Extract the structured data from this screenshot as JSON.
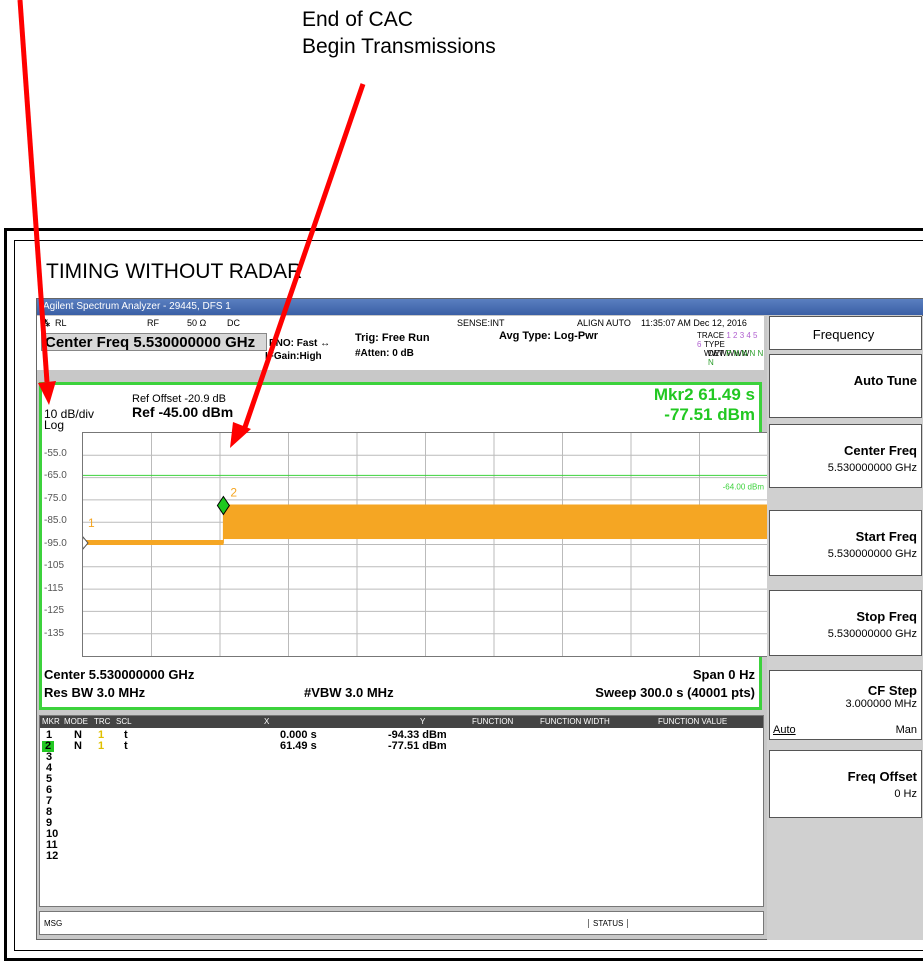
{
  "annotation": {
    "line1": "End of CAC",
    "line2": "Begin Transmissions"
  },
  "figure_title": "TIMING WITHOUT RADAR",
  "window_title": "Agilent Spectrum Analyzer - 29445, DFS 1",
  "status": {
    "rl": "RL",
    "rf": "RF",
    "ohm": "50 Ω",
    "dc": "DC",
    "sense": "SENSE:INT",
    "align": "ALIGN AUTO",
    "datetime": "11:35:07 AM Dec 12, 2016"
  },
  "header": {
    "center_freq": "Center Freq  5.530000000 GHz",
    "pno": "PNO: Fast",
    "ifgain": "IFGain:High",
    "trig": "Trig: Free Run",
    "atten": "#Atten: 0 dB",
    "avg": "Avg Type: Log-Pwr",
    "trace_label": "TRACE",
    "trace_vals": "1 2 3 4 5 6",
    "type_label": "TYPE",
    "type_vals": "WWWWWW",
    "det_label": "DET",
    "det_vals": "P N N N N N"
  },
  "plot": {
    "ref_offset": "Ref Offset -20.9 dB",
    "scale": "10 dB/div",
    "ref": "Ref -45.00 dBm",
    "log": "Log",
    "mkr_readout1": "Mkr2 61.49 s",
    "mkr_readout2": "-77.51 dBm",
    "threshold_label": "-64.00 dBm",
    "yticks": [
      "-55.0",
      "-65.0",
      "-75.0",
      "-85.0",
      "-95.0",
      "-105",
      "-115",
      "-125",
      "-135"
    ],
    "center": "Center 5.530000000 GHz",
    "span": "Span 0 Hz",
    "rbw": "Res BW 3.0 MHz",
    "vbw": "#VBW 3.0 MHz",
    "sweep": "Sweep  300.0 s (40001 pts)",
    "marker1_label": "1",
    "marker2_label": "2"
  },
  "chart_data": {
    "type": "line",
    "xlabel": "",
    "ylabel": "",
    "xlim": [
      0,
      300
    ],
    "ylim": [
      -145,
      -45
    ],
    "threshold": -64.0,
    "series": [
      {
        "x": [
          0,
          61.49,
          61.49,
          300
        ],
        "y": [
          -94.33,
          -94.33,
          -77.51,
          -77.51
        ]
      }
    ],
    "markers": [
      {
        "x": 0,
        "y": -94.33
      },
      {
        "x": 61.49,
        "y": -77.51
      }
    ]
  },
  "table": {
    "headers": [
      "MKR",
      "MODE",
      "TRC",
      "SCL",
      "X",
      "Y",
      "FUNCTION",
      "FUNCTION WIDTH",
      "FUNCTION VALUE"
    ],
    "rows": [
      {
        "n": "1",
        "mode": "N",
        "trc": "1",
        "scl": "t",
        "x": "0.000 s",
        "y": "-94.33 dBm"
      },
      {
        "n": "2",
        "mode": "N",
        "trc": "1",
        "scl": "t",
        "x": "61.49 s",
        "y": "-77.51 dBm"
      },
      {
        "n": "3"
      },
      {
        "n": "4"
      },
      {
        "n": "5"
      },
      {
        "n": "6"
      },
      {
        "n": "7"
      },
      {
        "n": "8"
      },
      {
        "n": "9"
      },
      {
        "n": "10"
      },
      {
        "n": "11"
      },
      {
        "n": "12"
      }
    ]
  },
  "msgbar": {
    "msg": "MSG",
    "status": "STATUS"
  },
  "softkeys": {
    "title": "Frequency",
    "auto_tune": "Auto Tune",
    "center_freq": "Center Freq",
    "center_val": "5.530000000 GHz",
    "start_freq": "Start Freq",
    "start_val": "5.530000000 GHz",
    "stop_freq": "Stop Freq",
    "stop_val": "5.530000000 GHz",
    "cf_step": "CF Step",
    "cf_step_val": "3.000000 MHz",
    "auto": "Auto",
    "man": "Man",
    "freq_offset": "Freq Offset",
    "freq_offset_val": "0 Hz"
  },
  "colors": {
    "trace": "#f5a623",
    "marker": "#1ec81e",
    "frame": "#3cd23c",
    "arrow": "#ff0000"
  }
}
